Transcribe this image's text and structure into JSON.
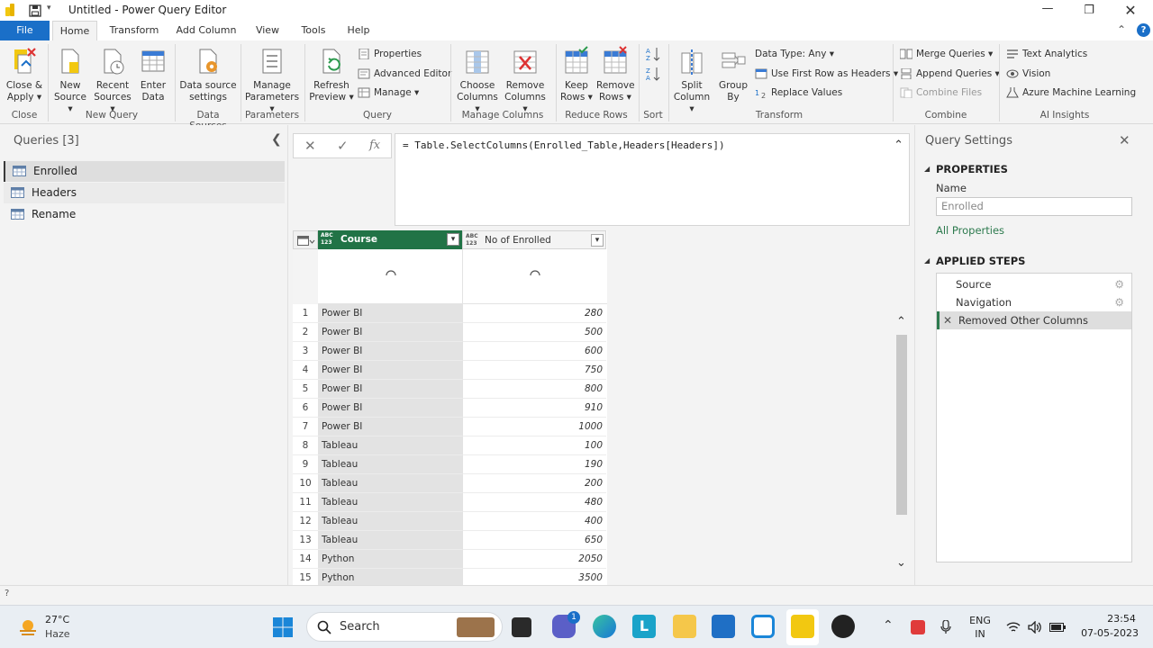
{
  "window": {
    "title": "Untitled - Power Query Editor"
  },
  "tabs": [
    "File",
    "Home",
    "Transform",
    "Add Column",
    "View",
    "Tools",
    "Help"
  ],
  "ribbon": {
    "close_apply": "Close &\nApply",
    "close_apply_l1": "Close &",
    "close_apply_l2": "Apply",
    "group_close": "Close",
    "new_source_l1": "New",
    "new_source_l2": "Source",
    "recent_sources_l1": "Recent",
    "recent_sources_l2": "Sources",
    "enter_data_l1": "Enter",
    "enter_data_l2": "Data",
    "group_new_query": "New Query",
    "ds_settings_l1": "Data source",
    "ds_settings_l2": "settings",
    "group_data_sources": "Data Sources",
    "manage_params_l1": "Manage",
    "manage_params_l2": "Parameters",
    "group_parameters": "Parameters",
    "refresh_l1": "Refresh",
    "refresh_l2": "Preview",
    "properties": "Properties",
    "advanced_editor": "Advanced Editor",
    "manage": "Manage",
    "group_query": "Query",
    "choose_cols_l1": "Choose",
    "choose_cols_l2": "Columns",
    "remove_cols_l1": "Remove",
    "remove_cols_l2": "Columns",
    "group_manage_columns": "Manage Columns",
    "keep_rows_l1": "Keep",
    "keep_rows_l2": "Rows",
    "remove_rows_l1": "Remove",
    "remove_rows_l2": "Rows",
    "group_reduce_rows": "Reduce Rows",
    "group_sort": "Sort",
    "split_col_l1": "Split",
    "split_col_l2": "Column",
    "group_by_l1": "Group",
    "group_by_l2": "By",
    "data_type": "Data Type: Any",
    "first_row_headers": "Use First Row as Headers",
    "replace_values": "Replace Values",
    "group_transform": "Transform",
    "merge_queries": "Merge Queries",
    "append_queries": "Append Queries",
    "combine_files": "Combine Files",
    "group_combine": "Combine",
    "text_analytics": "Text Analytics",
    "vision": "Vision",
    "azure_ml": "Azure Machine Learning",
    "group_ai": "AI Insights"
  },
  "queries": {
    "title": "Queries [3]",
    "items": [
      {
        "label": "Enrolled"
      },
      {
        "label": "Headers"
      },
      {
        "label": "Rename"
      }
    ]
  },
  "formula": {
    "text": "= Table.SelectColumns(Enrolled_Table,Headers[Headers])",
    "fx": "fx"
  },
  "grid": {
    "type_badge": "ABC\n123",
    "type_top": "ABC",
    "type_bottom": "123",
    "columns": [
      "Course",
      "No of Enrolled"
    ],
    "rows": [
      {
        "n": "1",
        "course": "Power BI",
        "enrolled": "280"
      },
      {
        "n": "2",
        "course": "Power BI",
        "enrolled": "500"
      },
      {
        "n": "3",
        "course": "Power BI",
        "enrolled": "600"
      },
      {
        "n": "4",
        "course": "Power BI",
        "enrolled": "750"
      },
      {
        "n": "5",
        "course": "Power BI",
        "enrolled": "800"
      },
      {
        "n": "6",
        "course": "Power BI",
        "enrolled": "910"
      },
      {
        "n": "7",
        "course": "Power BI",
        "enrolled": "1000"
      },
      {
        "n": "8",
        "course": "Tableau",
        "enrolled": "100"
      },
      {
        "n": "9",
        "course": "Tableau",
        "enrolled": "190"
      },
      {
        "n": "10",
        "course": "Tableau",
        "enrolled": "200"
      },
      {
        "n": "11",
        "course": "Tableau",
        "enrolled": "480"
      },
      {
        "n": "12",
        "course": "Tableau",
        "enrolled": "400"
      },
      {
        "n": "13",
        "course": "Tableau",
        "enrolled": "650"
      },
      {
        "n": "14",
        "course": "Python",
        "enrolled": "2050"
      },
      {
        "n": "15",
        "course": "Python",
        "enrolled": "3500"
      }
    ]
  },
  "settings": {
    "title": "Query Settings",
    "properties_header": "PROPERTIES",
    "name_label": "Name",
    "name_value": "Enrolled",
    "all_properties": "All Properties",
    "applied_steps_header": "APPLIED STEPS",
    "steps": [
      {
        "label": "Source"
      },
      {
        "label": "Navigation"
      },
      {
        "label": "Removed Other Columns"
      }
    ]
  },
  "statusbar": {
    "text": "?"
  },
  "taskbar": {
    "weather_temp": "27°C",
    "weather_desc": "Haze",
    "search": "Search",
    "lang_l1": "ENG",
    "lang_l2": "IN",
    "time": "23:54",
    "date": "07-05-2023",
    "notif_count": "1"
  },
  "colors": {
    "accent_blue": "#1a6fc8",
    "header_green": "#217346",
    "step_green": "#2d7a4e"
  }
}
